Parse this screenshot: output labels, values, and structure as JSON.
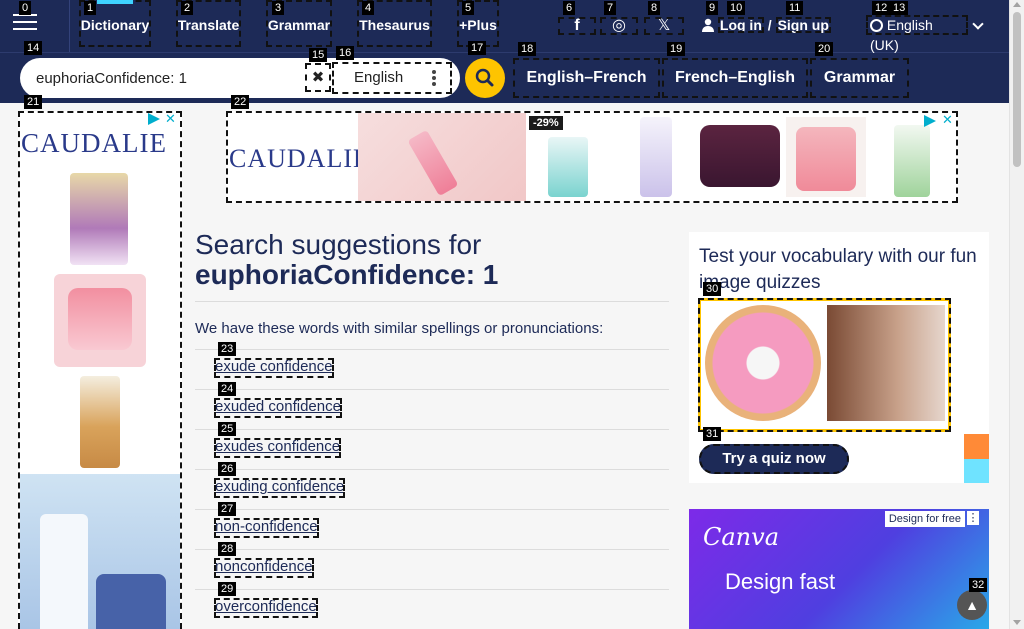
{
  "header": {
    "menu_icon": "hamburger-icon",
    "nav": [
      {
        "label": "Dictionary",
        "badge": "1"
      },
      {
        "label": "Translate",
        "badge": "2"
      },
      {
        "label": "Grammar",
        "badge": "3"
      },
      {
        "label": "Thesaurus",
        "badge": "4"
      },
      {
        "label": "+Plus",
        "badge": "5"
      }
    ],
    "menu_badge": "0",
    "social": [
      {
        "icon": "facebook-icon",
        "glyph": "f",
        "badge": "6"
      },
      {
        "icon": "instagram-icon",
        "glyph": "◎",
        "badge": "7"
      },
      {
        "icon": "x-twitter-icon",
        "glyph": "𝕏",
        "badge": "8"
      }
    ],
    "login": {
      "login_label": "Log in",
      "sep": "/",
      "signup_label": "Sign up",
      "badge_user": "9",
      "badge_login": "10",
      "badge_signup": "11"
    },
    "language": {
      "label": "English (UK)",
      "badge_a": "12",
      "badge_b": "13"
    }
  },
  "search": {
    "value": "euphoriaConfidence: 1",
    "badge_input": "14",
    "badge_clear": "15",
    "dictionary": "English",
    "badge_dict": "16",
    "badge_go": "17"
  },
  "subnav": [
    {
      "label": "English–French",
      "badge": "18"
    },
    {
      "label": "French–English",
      "badge": "19"
    },
    {
      "label": "Grammar",
      "badge": "20"
    }
  ],
  "ads": {
    "left_badge": "21",
    "top_badge": "22",
    "brand": "CAUDALIE",
    "discount": "-29%",
    "canva_brand": "Canva",
    "canva_cta": "Design for free",
    "canva_tagline": "Design fast"
  },
  "main": {
    "title_prefix": "Search suggestions for",
    "title_query": "euphoriaConfidence: 1",
    "intro": "We have these words with similar spellings or pronunciations:",
    "suggestions": [
      {
        "text": "exude confidence",
        "badge": "23"
      },
      {
        "text": "exuded confidence",
        "badge": "24"
      },
      {
        "text": "exudes confidence",
        "badge": "25"
      },
      {
        "text": "exuding confidence",
        "badge": "26"
      },
      {
        "text": "non-confidence",
        "badge": "27"
      },
      {
        "text": "nonconfidence",
        "badge": "28"
      },
      {
        "text": "overconfidence",
        "badge": "29"
      }
    ]
  },
  "quiz": {
    "title": "Test your vocabulary with our fun image quizzes",
    "image_badge": "30",
    "button": "Try a quiz now",
    "button_badge": "31"
  },
  "scroll_top_badge": "32",
  "colors": {
    "brand_navy": "#1d2a57",
    "accent_yellow": "#fec400",
    "accent_cyan": "#3fd3ff"
  }
}
